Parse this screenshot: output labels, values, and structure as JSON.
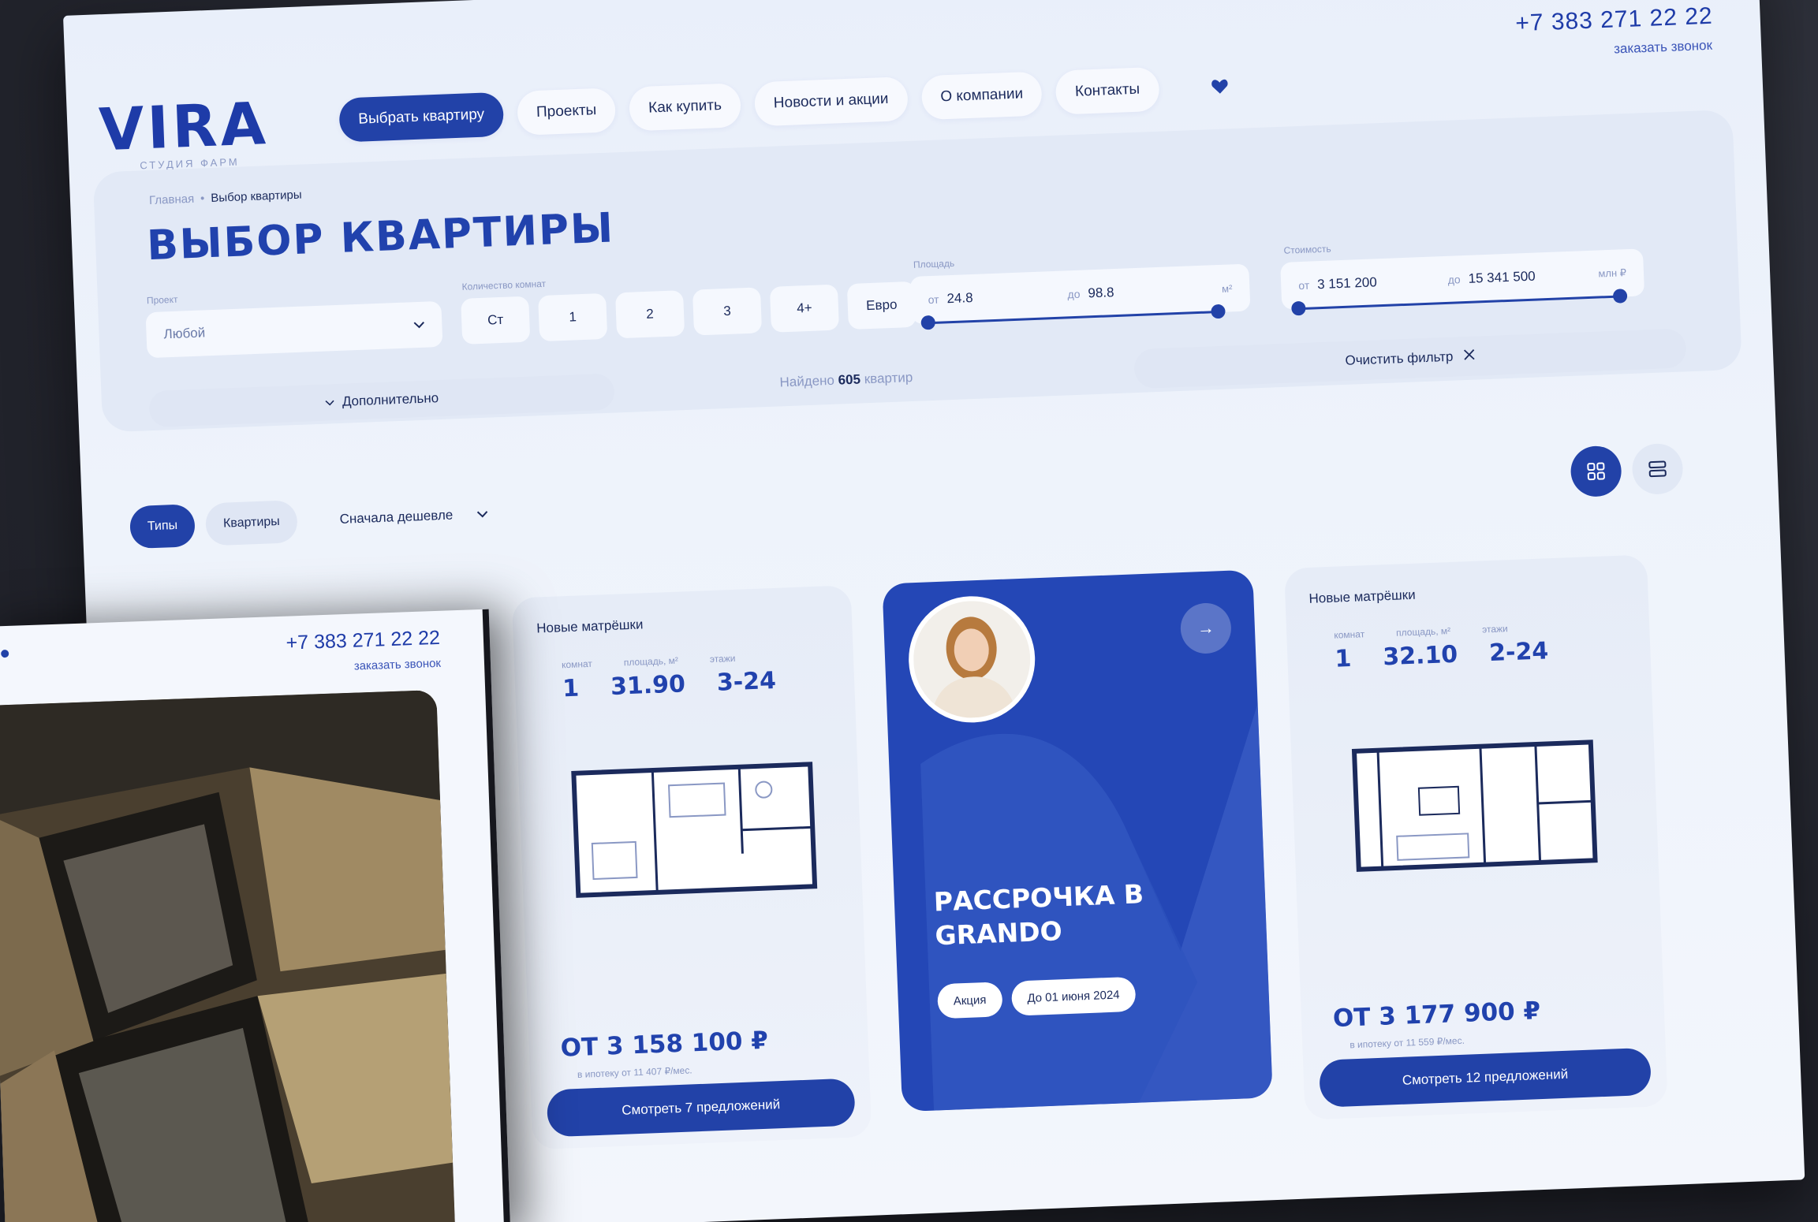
{
  "brand": {
    "logo": "VIRA",
    "logo_sub": "СТУДИЯ ФАРМ"
  },
  "header": {
    "nav": [
      "Выбрать квартиру",
      "Проекты",
      "Как купить",
      "Новости и акции",
      "О компании",
      "Контакты"
    ],
    "phone": "+7 383 271 22 22",
    "callback": "заказать звонок"
  },
  "filters": {
    "breadcrumb_home": "Главная",
    "breadcrumb_sep": "•",
    "breadcrumb_current": "Выбор квартиры",
    "title": "ВЫБОР КВАРТИРЫ",
    "project_label": "Проект",
    "project_value": "Любой",
    "rooms_label": "Количество комнат",
    "rooms": [
      "Ст",
      "1",
      "2",
      "3",
      "4+",
      "Евро"
    ],
    "area_label": "Площадь",
    "area_from_prefix": "от",
    "area_from": "24.8",
    "area_to_prefix": "до",
    "area_to": "98.8",
    "area_unit": "м²",
    "price_label": "Стоимость",
    "price_from_prefix": "от",
    "price_from": "3 151 200",
    "price_to_prefix": "до",
    "price_to": "15 341 500",
    "price_unit": "млн ₽",
    "extra": "Дополнительно",
    "found_prefix": "Найдено",
    "found_count": "605",
    "found_suffix": "квартир",
    "clear": "Очистить фильтр"
  },
  "toolbar": {
    "tab_types": "Типы",
    "tab_flats": "Квартиры",
    "sort": "Сначала дешевле"
  },
  "cards": [
    {
      "title": "Новые матрёшки",
      "label_rooms": "комнат",
      "label_area": "площадь, м²",
      "label_floors": "этажи",
      "rooms": "1",
      "area": "31.90",
      "floors": "3-24",
      "price": "ОТ 3 158 100 ₽",
      "price_sub": "в ипотеку от 11 407 ₽/мес.",
      "button": "Смотреть 7 предложений"
    },
    {
      "title": "Новые матрёшки",
      "label_rooms": "комнат",
      "label_area": "площадь, м²",
      "label_floors": "этажи",
      "rooms": "1",
      "area": "32.10",
      "floors": "2-24",
      "price": "ОТ 3 177 900 ₽",
      "price_sub": "в ипотеку от 11 559 ₽/мес.",
      "button": "Смотреть 12 предложений"
    }
  ],
  "promo": {
    "title": "РАССРОЧКА В GRANDO",
    "tag1": "Акция",
    "tag2": "До 01 июня 2024"
  },
  "overlay": {
    "phone": "+7 383 271 22 22",
    "callback": "заказать звонок"
  },
  "colors": {
    "accent": "#2242a8",
    "panel": "#e2e9f6",
    "background": "#24262f"
  }
}
